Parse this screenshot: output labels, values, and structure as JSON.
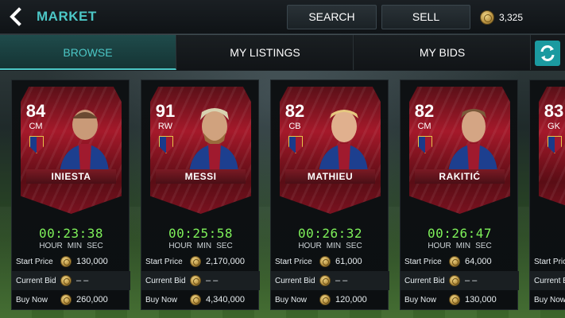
{
  "header": {
    "title": "MARKET",
    "search_label": "SEARCH",
    "sell_label": "SELL",
    "coins": "3,325"
  },
  "tabs": [
    {
      "label": "BROWSE",
      "active": true
    },
    {
      "label": "MY LISTINGS",
      "active": false
    },
    {
      "label": "MY BIDS",
      "active": false
    }
  ],
  "labels": {
    "start_price": "Start Price",
    "current_bid": "Current Bid",
    "buy_now": "Buy Now",
    "hour": "HOUR",
    "min": "MIN",
    "sec": "SEC"
  },
  "cards": [
    {
      "rating": "84",
      "position": "CM",
      "name": "INIESTA",
      "timer": "00:23:38",
      "start_price": "130,000",
      "current_bid": "– –",
      "buy_now": "260,000"
    },
    {
      "rating": "91",
      "position": "RW",
      "name": "MESSI",
      "timer": "00:25:58",
      "start_price": "2,170,000",
      "current_bid": "– –",
      "buy_now": "4,340,000"
    },
    {
      "rating": "82",
      "position": "CB",
      "name": "MATHIEU",
      "timer": "00:26:32",
      "start_price": "61,000",
      "current_bid": "– –",
      "buy_now": "120,000"
    },
    {
      "rating": "82",
      "position": "CM",
      "name": "RAKITIĆ",
      "timer": "00:26:47",
      "start_price": "64,000",
      "current_bid": "– –",
      "buy_now": "130,000"
    },
    {
      "rating": "83",
      "position": "GK",
      "name": "",
      "timer": "",
      "start_price": "",
      "current_bid": "",
      "buy_now": ""
    }
  ],
  "colors": {
    "accent": "#4cc7c6",
    "timer": "#7ef05a",
    "card_red": "#a5192a"
  },
  "icons": {
    "back": "back-arrow-icon",
    "coin": "coin-icon",
    "refresh": "refresh-icon",
    "club_crest": "club-crest-icon"
  }
}
